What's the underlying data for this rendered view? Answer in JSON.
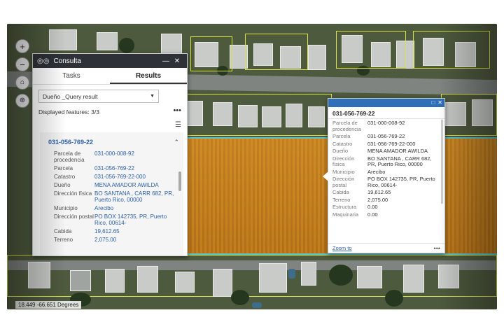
{
  "map": {
    "coordinates": "18.449 -66.651 Degrees",
    "tools": [
      "zoom-in",
      "zoom-out",
      "home",
      "locate"
    ]
  },
  "consulta": {
    "title": "Consulta",
    "tabs": {
      "tasks": "Tasks",
      "results": "Results"
    },
    "query_select": "Dueño _Query result",
    "displayed_features": "Displayed features: 3/3",
    "result": {
      "id": "031-056-769-22",
      "fields": [
        {
          "k": "Parcela de procedencia",
          "v": "031-000-008-92"
        },
        {
          "k": "Parcela",
          "v": "031-056-769-22"
        },
        {
          "k": "Catastro",
          "v": "031-056-769-22-000"
        },
        {
          "k": "Dueño",
          "v": "MENA AMADOR AWILDA"
        },
        {
          "k": "Dirección física",
          "v": "BO SANTANA , CARR 682, PR, Puerto Rico, 00000"
        },
        {
          "k": "Municipio",
          "v": "Arecibo"
        },
        {
          "k": "Dirección postal",
          "v": "PO BOX 142735, PR, Puerto Rico, 00614-"
        },
        {
          "k": "Cabida",
          "v": "19,612.65"
        },
        {
          "k": "Terreno",
          "v": "2,075.00"
        }
      ]
    }
  },
  "popup": {
    "id": "031-056-769-22",
    "fields": [
      {
        "k": "Parcela de procedencia",
        "v": "031-000-008-92"
      },
      {
        "k": "Parcela",
        "v": "031-056-769-22"
      },
      {
        "k": "Catastro",
        "v": "031-056-769-22-000"
      },
      {
        "k": "Dueño",
        "v": "MENA AMADOR AWILDA"
      },
      {
        "k": "Dirección física",
        "v": "BO SANTANA , CARR 682, PR, Puerto Rico, 00000"
      },
      {
        "k": "Municipio",
        "v": "Arecibo"
      },
      {
        "k": "Dirección postal",
        "v": "PO BOX 142735, PR, Puerto Rico, 00614-"
      },
      {
        "k": "Cabida",
        "v": "19,612.65"
      },
      {
        "k": "Terreno",
        "v": "2,075.00"
      },
      {
        "k": "Estructura",
        "v": "0.00"
      },
      {
        "k": "Maquinaria",
        "v": "0.00"
      }
    ],
    "zoom_to": "Zoom to"
  },
  "colors": {
    "parcel_fill": "#c8861e",
    "parcel_outline": "#59c3c9",
    "parcel_lines": "#d9e24a",
    "title_bar": "#2e3138",
    "popup_header": "#2e6fb7",
    "link": "#2b5fa6"
  }
}
